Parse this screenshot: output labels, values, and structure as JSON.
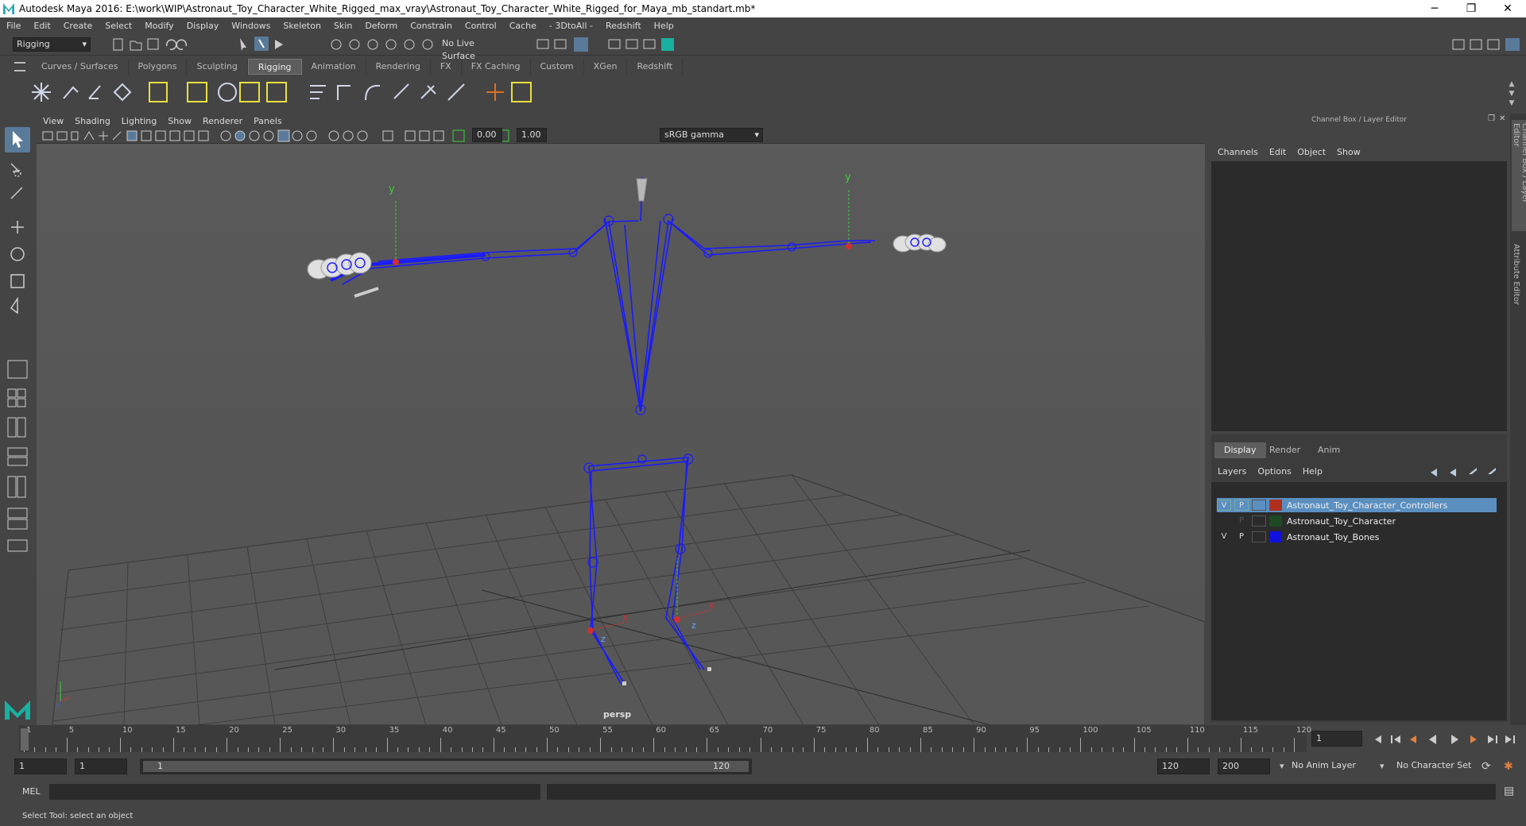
{
  "window": {
    "title": "Autodesk Maya 2016: E:\\work\\WIP\\Astronaut_Toy_Character_White_Rigged_max_vray\\Astronaut_Toy_Character_White_Rigged_for_Maya_mb_standart.mb*",
    "minimize": "─",
    "restore": "❐",
    "close": "✕"
  },
  "menubar": [
    "File",
    "Edit",
    "Create",
    "Select",
    "Modify",
    "Display",
    "Windows",
    "Skeleton",
    "Skin",
    "Deform",
    "Constrain",
    "Control",
    "Cache",
    "- 3DtoAll -",
    "Redshift",
    "Help"
  ],
  "toolbar": {
    "mode": "Rigging",
    "live_surface": "No Live Surface"
  },
  "shelf_tabs": [
    {
      "label": "Curves / Surfaces",
      "active": false
    },
    {
      "label": "Polygons",
      "active": false
    },
    {
      "label": "Sculpting",
      "active": false
    },
    {
      "label": "Rigging",
      "active": true
    },
    {
      "label": "Animation",
      "active": false
    },
    {
      "label": "Rendering",
      "active": false
    },
    {
      "label": "FX",
      "active": false
    },
    {
      "label": "FX Caching",
      "active": false
    },
    {
      "label": "Custom",
      "active": false
    },
    {
      "label": "XGen",
      "active": false
    },
    {
      "label": "Redshift",
      "active": false
    }
  ],
  "viewport": {
    "menu": [
      "View",
      "Shading",
      "Lighting",
      "Show",
      "Renderer",
      "Panels"
    ],
    "near_value": "0.00",
    "far_value": "1.00",
    "color_space": "sRGB gamma",
    "camera_label": "persp",
    "axis_y": "y",
    "axis_x": "x",
    "axis_z": "z"
  },
  "channel_box": {
    "title": "Channel Box / Layer Editor",
    "menu": [
      "Channels",
      "Edit",
      "Object",
      "Show"
    ]
  },
  "layer_editor": {
    "tabs": [
      {
        "label": "Display",
        "active": true
      },
      {
        "label": "Render",
        "active": false
      },
      {
        "label": "Anim",
        "active": false
      }
    ],
    "menu": [
      "Layers",
      "Options",
      "Help"
    ],
    "layers": [
      {
        "v": "V",
        "p": "P",
        "color": "#b03020",
        "name": "Astronaut_Toy_Character_Controllers",
        "selected": true
      },
      {
        "v": "",
        "p": "P",
        "color": "#1d4a22",
        "name": "Astronaut_Toy_Character",
        "selected": false
      },
      {
        "v": "V",
        "p": "P",
        "color": "#1010e0",
        "name": "Astronaut_Toy_Bones",
        "selected": false
      }
    ]
  },
  "side_strip": {
    "channel_box_tab": "Channel Box / Layer Editor",
    "attribute_editor_tab": "Attribute Editor"
  },
  "timeline": {
    "ticks": [
      "1",
      "5",
      "10",
      "15",
      "20",
      "25",
      "30",
      "35",
      "40",
      "45",
      "50",
      "55",
      "60",
      "65",
      "70",
      "75",
      "80",
      "85",
      "90",
      "95",
      "100",
      "105",
      "110",
      "115",
      "120"
    ],
    "current_frame": "1"
  },
  "range": {
    "start": "1",
    "playback_start": "1",
    "slider_start": "1",
    "slider_end": "120",
    "playback_end": "120",
    "end": "200",
    "anim_layer": "No Anim Layer",
    "character_set": "No Character Set"
  },
  "mel": {
    "label": "MEL"
  },
  "status": {
    "text": "Select Tool: select an object"
  },
  "colors": {
    "bones": "#1a1aff",
    "grid": "#3c3c3c",
    "selected_layer": "#5a8fc0"
  }
}
